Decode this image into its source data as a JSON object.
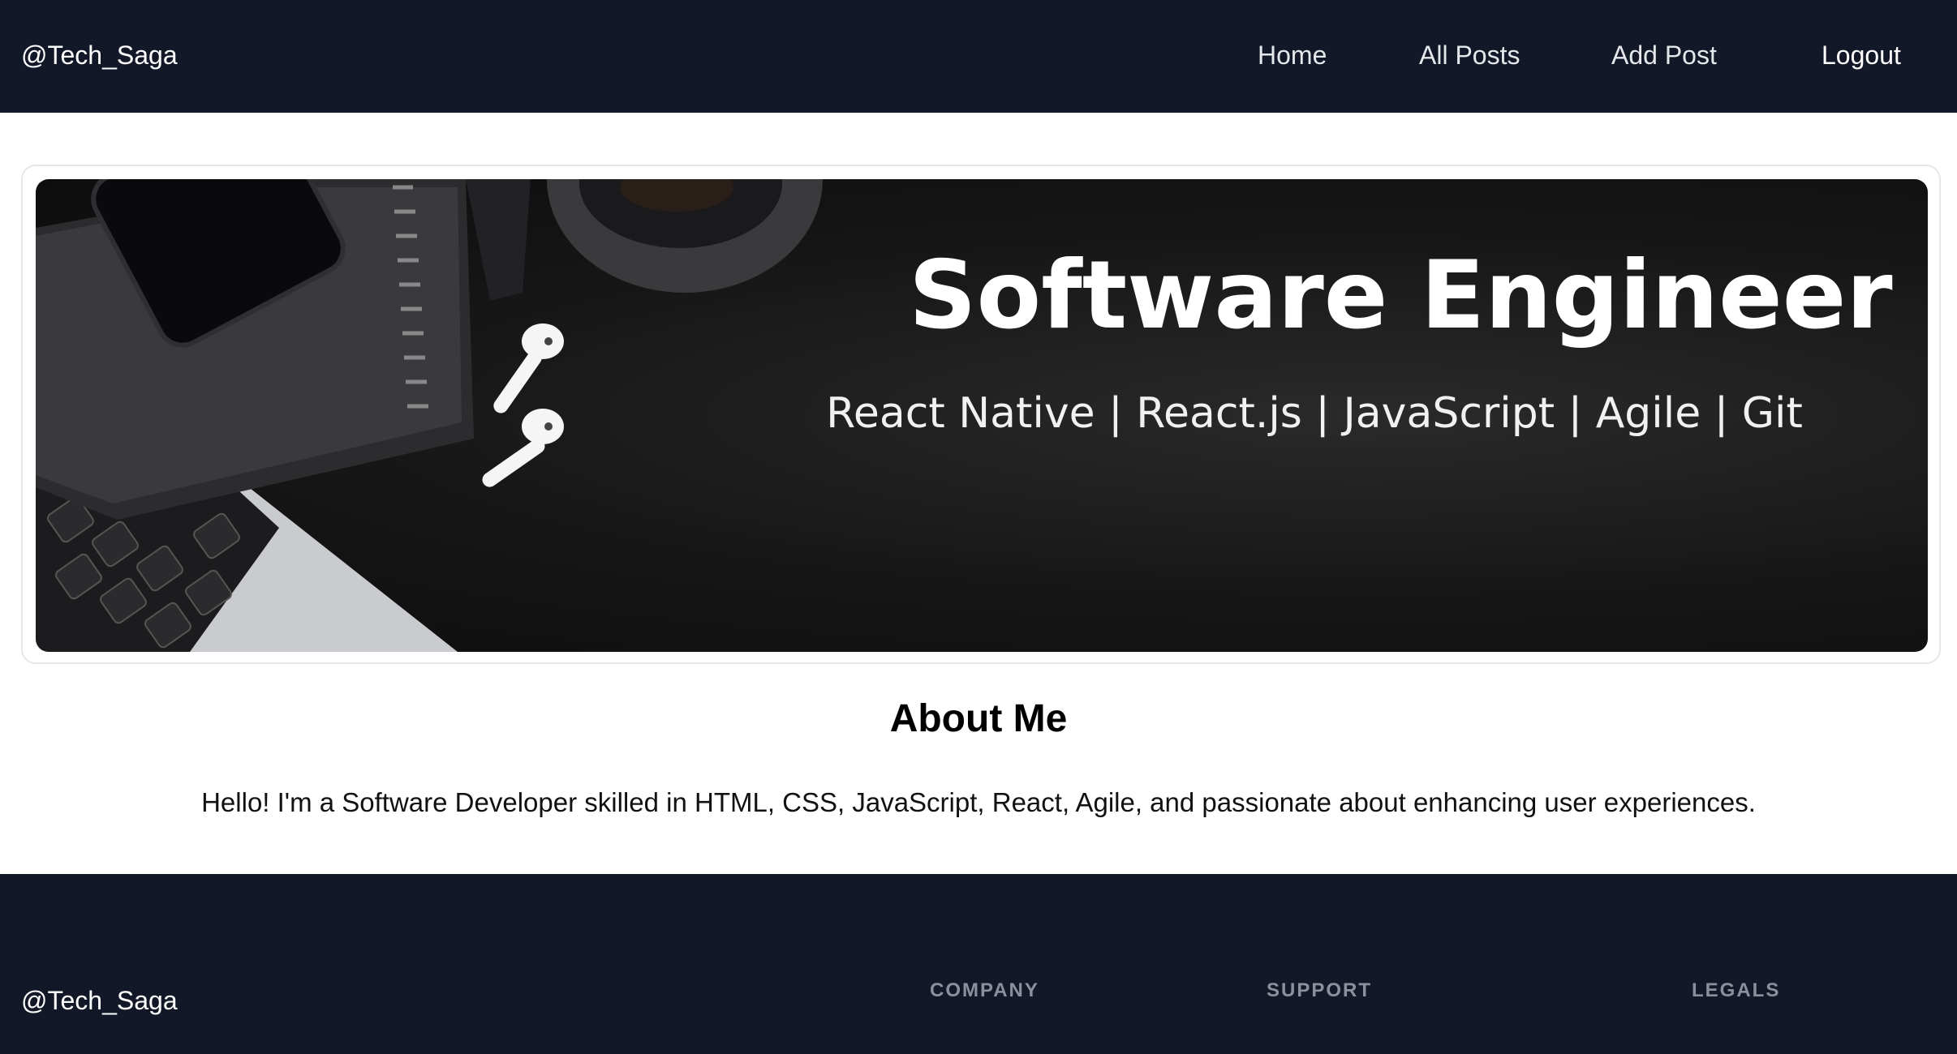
{
  "header": {
    "brand": "@Tech_Saga",
    "nav": {
      "home": "Home",
      "all_posts": "All Posts",
      "add_post": "Add Post",
      "logout": "Logout"
    }
  },
  "banner": {
    "title": "Software Engineer",
    "subtitle": "React Native | React.js | JavaScript | Agile | Git"
  },
  "about": {
    "title": "About Me",
    "text": "Hello! I'm a Software Developer skilled in HTML, CSS, JavaScript, React, Agile, and passionate about enhancing user experiences."
  },
  "footer": {
    "brand": "@Tech_Saga",
    "headings": {
      "company": "COMPANY",
      "support": "SUPPORT",
      "legals": "LEGALS"
    }
  },
  "colors": {
    "nav_background": "#121828",
    "footer_background": "#121828",
    "footer_heading": "#8b919c"
  }
}
